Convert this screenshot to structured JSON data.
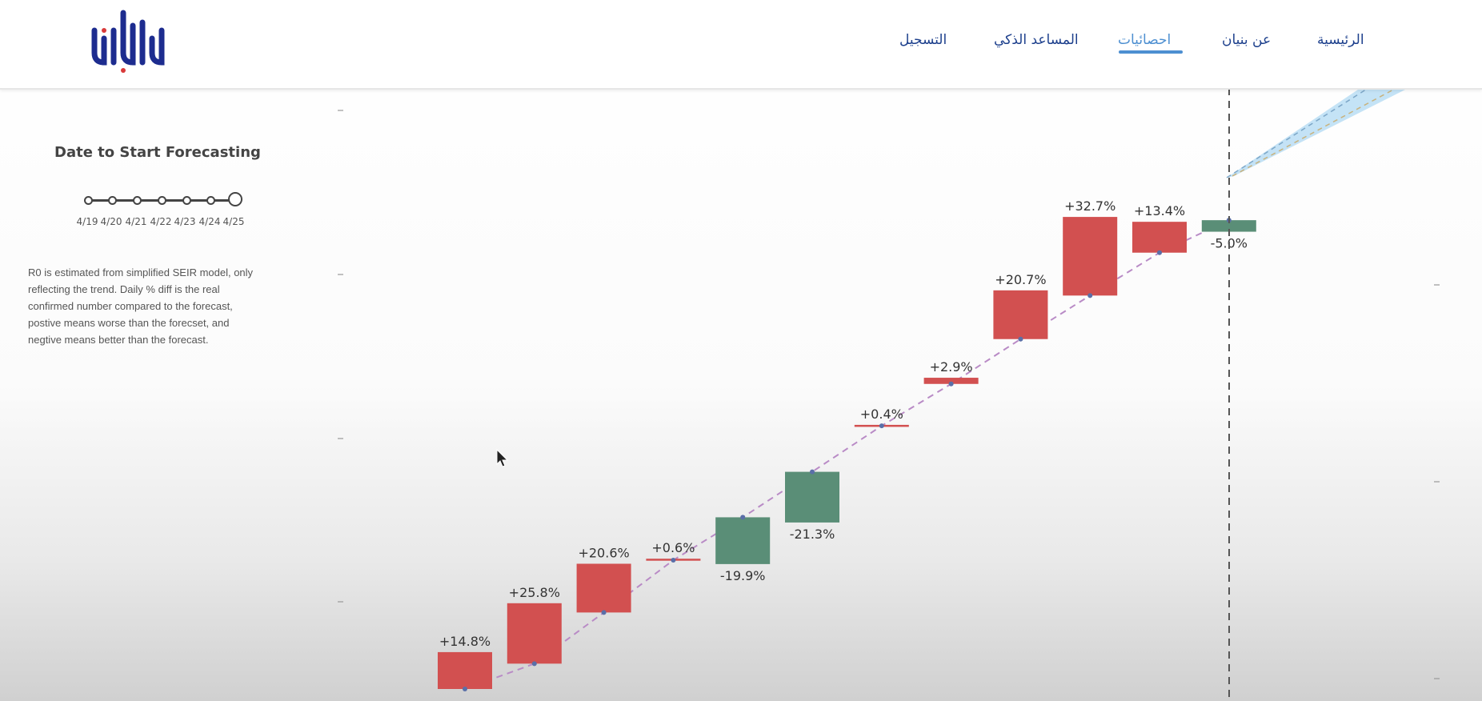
{
  "nav": {
    "logo_name": "Bonyan",
    "items": [
      {
        "label": "الرئيسية",
        "active": false
      },
      {
        "label": "عن بنيان",
        "active": false
      },
      {
        "label": "احصائيات",
        "active": true
      },
      {
        "label": "المساعد الذكي",
        "active": false
      },
      {
        "label": "التسجيل",
        "active": false
      }
    ],
    "colors": {
      "link": "#1c3f8c",
      "active": "#4d8fd1"
    }
  },
  "side_panel": {
    "heading": "Date to Start Forecasting",
    "slider": {
      "dates": [
        "4/19",
        "4/20",
        "4/21",
        "4/22",
        "4/23",
        "4/24",
        "4/25"
      ],
      "selected": "4/25"
    },
    "note": "R0 is estimated from simplified SEIR model, only reflecting the trend. Daily % diff is the real confirmed number compared to the forecast, postive means worse than the forecset, and negtive means better than the forecast."
  },
  "chart_data": {
    "type": "bar",
    "title": "",
    "xlabel": "",
    "ylabel": "",
    "colors": {
      "positive": "#d25050",
      "negative": "#5a8e77",
      "forecast_line": "#b98bc6",
      "band": "#9dd0f0"
    },
    "bars": [
      {
        "label": "+14.8%",
        "forecast": 0.0,
        "actual": 22.7
      },
      {
        "label": "+25.8%",
        "forecast": 15.6,
        "actual": 52.8
      },
      {
        "label": "+20.6%",
        "forecast": 47.1,
        "actual": 77.1
      },
      {
        "label": "+0.6%",
        "forecast": 79.3,
        "actual": 80.2
      },
      {
        "label": "-19.9%",
        "forecast": 105.7,
        "actual": 76.9
      },
      {
        "label": "-21.3%",
        "forecast": 133.7,
        "actual": 102.5
      },
      {
        "label": "+0.4%",
        "forecast": 162.0,
        "actual": 162.6
      },
      {
        "label": "+2.9%",
        "forecast": 187.8,
        "actual": 191.6
      },
      {
        "label": "+20.7%",
        "forecast": 215.4,
        "actual": 245.4
      },
      {
        "label": "+32.7%",
        "forecast": 242.2,
        "actual": 290.6
      },
      {
        "label": "+13.4%",
        "forecast": 268.6,
        "actual": 287.6
      },
      {
        "label": "-5.0%",
        "forecast": 288.6,
        "actual": 281.5
      }
    ],
    "forecast_start_marker": true,
    "forecast_band": true
  }
}
